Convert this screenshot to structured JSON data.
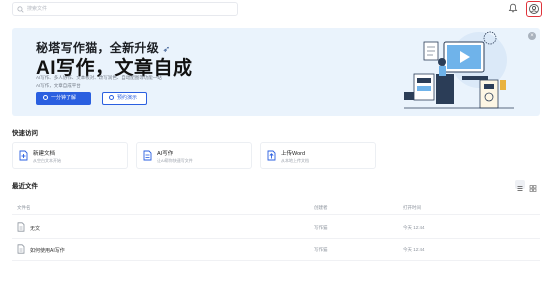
{
  "search": {
    "placeholder": "搜索文件"
  },
  "banner": {
    "title": "秘塔写作猫，全新升级",
    "headline": "AI写作，文章自成",
    "desc_line1": "AI写作、多人协作、文本校对、改写润色、自动配图等功能一站",
    "desc_line2": "AI写作，文章自成平台",
    "primary_button": "一分钟了解",
    "secondary_button": "预约演示"
  },
  "quick_access": {
    "title": "快速访问",
    "cards": [
      {
        "title": "新建文档",
        "subtitle": "从空白文本开始",
        "icon": "new-doc-icon"
      },
      {
        "title": "AI写作",
        "subtitle": "让AI帮你快速写文件",
        "icon": "ai-write-icon"
      },
      {
        "title": "上传Word",
        "subtitle": "从本地上传文档",
        "icon": "upload-word-icon"
      }
    ]
  },
  "recent": {
    "title": "最近文件",
    "columns": {
      "name": "文件名",
      "owner": "创建者",
      "opened": "打开时间"
    },
    "rows": [
      {
        "name": "无文",
        "owner": "写作猫",
        "opened": "今天 12:44"
      },
      {
        "name": "如何使用AI写作",
        "owner": "写作猫",
        "opened": "今天 12:44"
      }
    ]
  },
  "colors": {
    "accent": "#2a5fe0",
    "banner_bg": "#eaf3fc",
    "avatar_border": "#e0333a"
  }
}
